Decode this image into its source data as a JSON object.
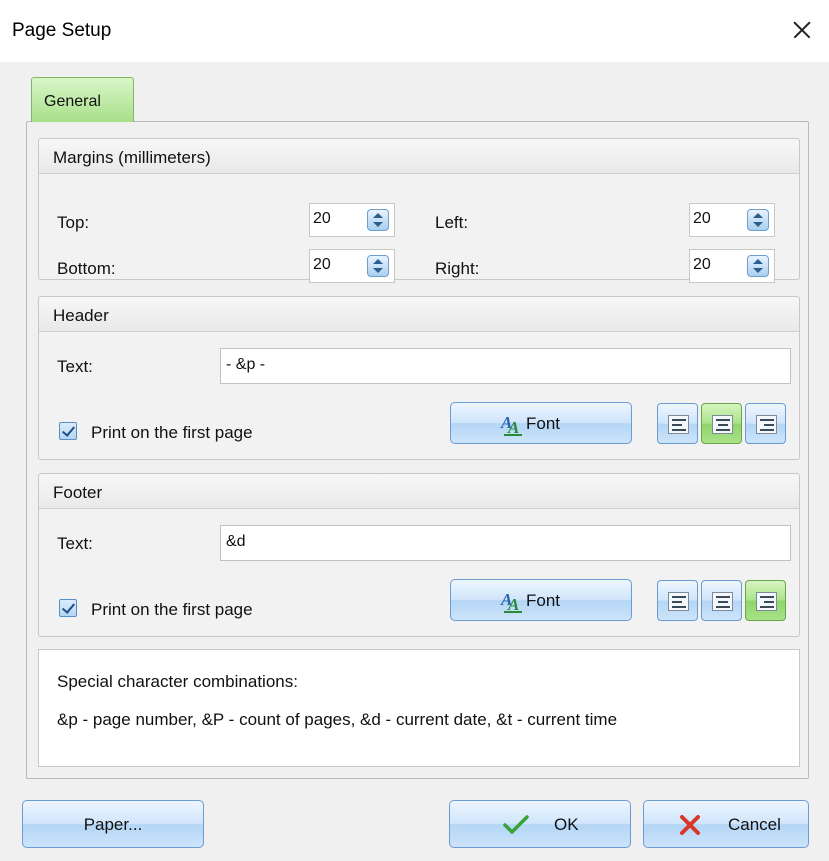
{
  "window": {
    "title": "Page Setup"
  },
  "tabs": [
    {
      "label": "General",
      "active": true
    }
  ],
  "margins": {
    "title": "Margins (millimeters)",
    "top_label": "Top:",
    "top_value": "20",
    "bottom_label": "Bottom:",
    "bottom_value": "20",
    "left_label": "Left:",
    "left_value": "20",
    "right_label": "Right:",
    "right_value": "20"
  },
  "header": {
    "title": "Header",
    "text_label": "Text:",
    "text_value": "- &p -",
    "first_page_label": "Print on the first page",
    "first_page_checked": true,
    "font_label": "Font",
    "alignment": "center"
  },
  "footer": {
    "title": "Footer",
    "text_label": "Text:",
    "text_value": "&d",
    "first_page_label": "Print on the first page",
    "first_page_checked": true,
    "font_label": "Font",
    "alignment": "right"
  },
  "info": {
    "title": "Special character combinations:",
    "text": "&p - page number, &P - count of pages, &d - current date, &t - current time"
  },
  "buttons": {
    "paper": "Paper...",
    "ok": "OK",
    "cancel": "Cancel"
  },
  "colors": {
    "active_green": "#a8e08a",
    "button_blue": "#cfe5fb",
    "ok_check": "#3aa335",
    "cancel_x": "#d9362b"
  },
  "icons": [
    "close-icon",
    "spin-icon",
    "checkbox-icon",
    "font-icon",
    "align-left-icon",
    "align-center-icon",
    "align-right-icon",
    "ok-check-icon",
    "cancel-x-icon"
  ]
}
